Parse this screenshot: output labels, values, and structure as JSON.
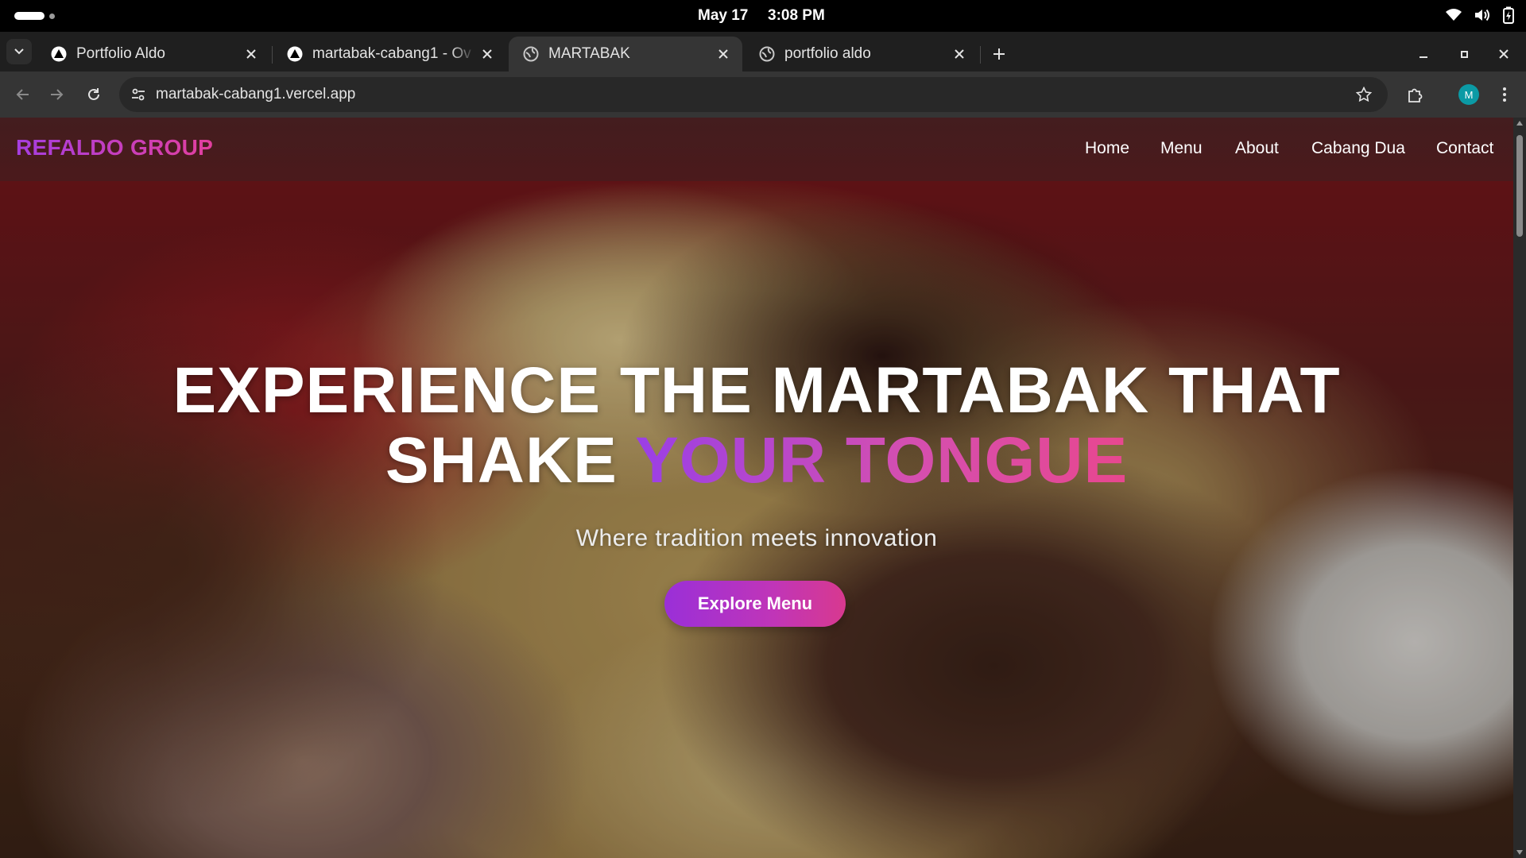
{
  "os": {
    "date": "May 17",
    "time": "3:08 PM"
  },
  "tabs": [
    {
      "title": "Portfolio Aldo",
      "favicon": "triangle-icon"
    },
    {
      "title": "martabak-cabang1 - Ov",
      "favicon": "triangle-icon"
    },
    {
      "title": "MARTABAK",
      "favicon": "globe-icon",
      "active": true
    },
    {
      "title": "portfolio aldo",
      "favicon": "globe-icon"
    }
  ],
  "toolbar": {
    "url": "martabak-cabang1.vercel.app",
    "avatar_letter": "M",
    "avatar_color": "#0b9aa5"
  },
  "site": {
    "brand": "REFALDO GROUP",
    "nav": [
      "Home",
      "Menu",
      "About",
      "Cabang Dua",
      "Contact"
    ],
    "headline_line1": "EXPERIENCE THE MARTABAK THAT",
    "headline_line2_plain": "SHAKE ",
    "headline_line2_highlight": "YOUR TONGUE",
    "subtitle": "Where tradition meets innovation",
    "cta_label": "Explore Menu",
    "accent_start": "#9a2fd8",
    "accent_end": "#e23f9e"
  }
}
